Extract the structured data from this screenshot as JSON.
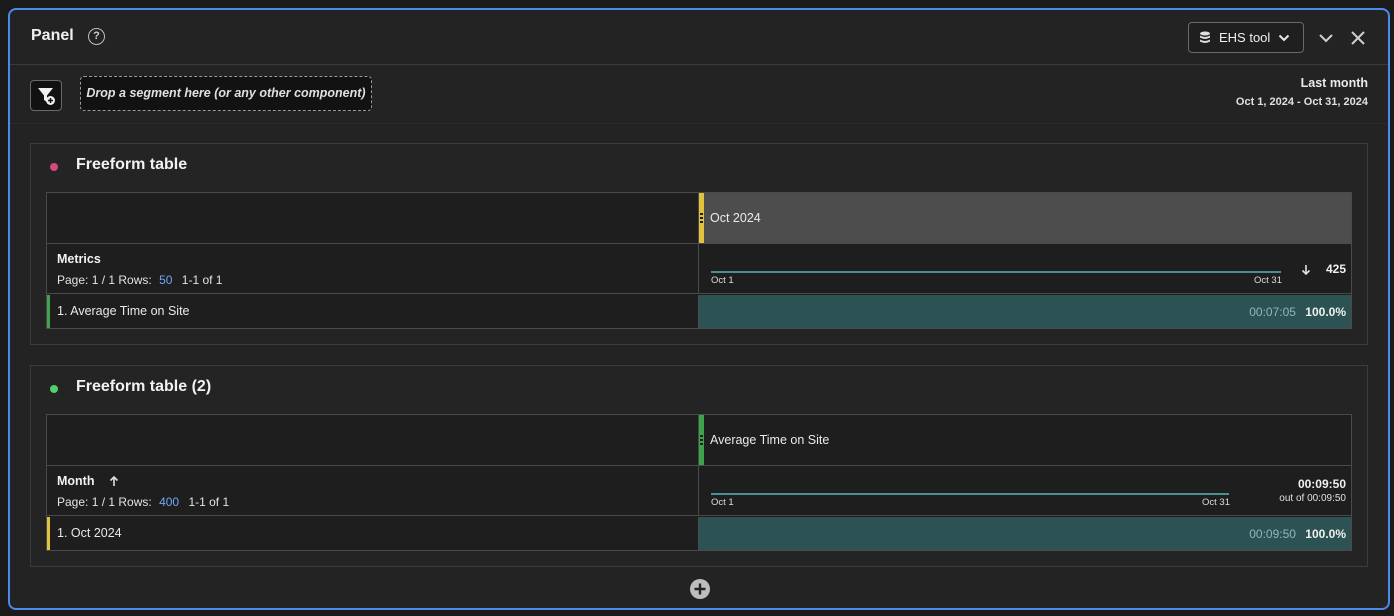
{
  "panel": {
    "title": "Panel",
    "data_source": "EHS tool",
    "segment_drop_placeholder": "Drop a segment here (or any other component)",
    "date_label": "Last month",
    "date_range": "Oct 1, 2024 - Oct 31, 2024"
  },
  "colors": {
    "accent_border": "#4b8ae8",
    "pink_dot": "#d4477f",
    "green_dot": "#4fd06a",
    "yellow_accent": "#e0c23c",
    "green_accent": "#3fa34d",
    "teal_cell": "#2c5254"
  },
  "tables": [
    {
      "title": "Freeform table",
      "column_header": "Oct 2024",
      "dimension_label": "Metrics",
      "page_text": "Page: 1 / 1",
      "rows_label": "Rows:",
      "rows_value": "50",
      "range_text": "1-1 of 1",
      "spark_start": "Oct 1",
      "spark_end": "Oct 31",
      "total_value": "425",
      "row": {
        "label": "1.  Average Time on Site",
        "value": "00:07:05",
        "percent": "100.0%"
      }
    },
    {
      "title": "Freeform table (2)",
      "column_header": "Average Time on Site",
      "dimension_label": "Month",
      "page_text": "Page: 1 / 1",
      "rows_label": "Rows:",
      "rows_value": "400",
      "range_text": "1-1 of 1",
      "spark_start": "Oct 1",
      "spark_end": "Oct 31",
      "total_value": "00:09:50",
      "total_sub": "out of 00:09:50",
      "row": {
        "label": "1.  Oct 2024",
        "value": "00:09:50",
        "percent": "100.0%"
      }
    }
  ]
}
